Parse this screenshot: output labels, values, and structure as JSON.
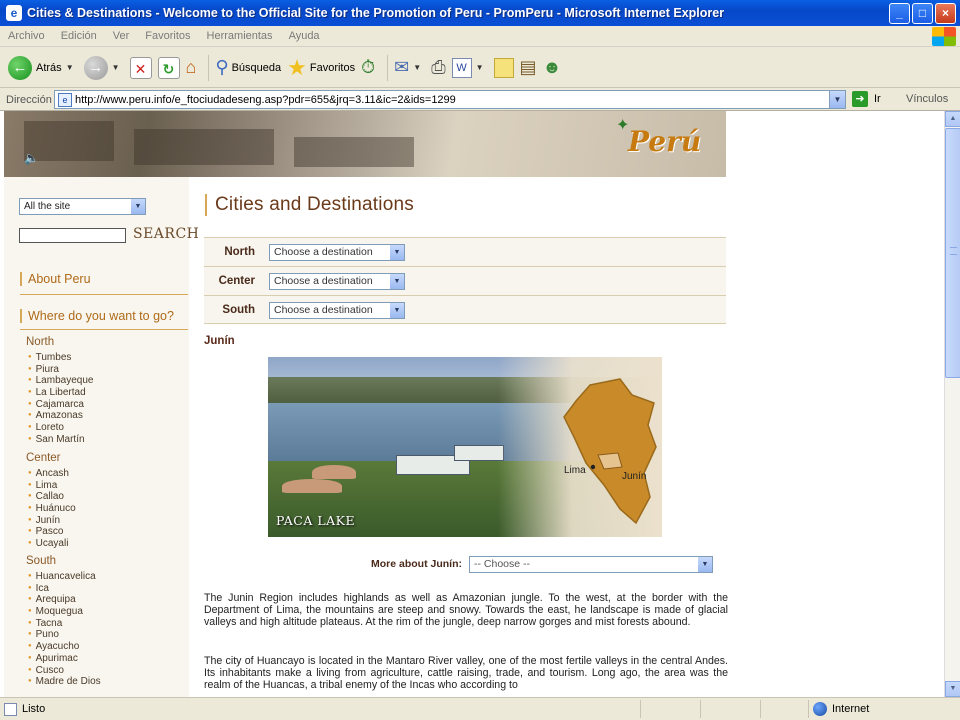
{
  "window": {
    "title": "Cities & Destinations - Welcome to the Official Site for the Promotion of Peru - PromPeru - Microsoft Internet Explorer",
    "buttons": {
      "minimize": "_",
      "maximize": "□",
      "close": "×"
    }
  },
  "menu": [
    "Archivo",
    "Edición",
    "Ver",
    "Favoritos",
    "Herramientas",
    "Ayuda"
  ],
  "toolbar": {
    "back_label": "Atrás",
    "search_label": "Búsqueda",
    "favorites_label": "Favoritos"
  },
  "address": {
    "label": "Dirección",
    "url": "http://www.peru.info/e_ftociudadeseng.asp?pdr=655&jrq=3.11&ic=2&ids=1299",
    "go_label": "Ir",
    "links_label": "Vínculos"
  },
  "status": {
    "left": "Listo",
    "zone": "Internet"
  },
  "page": {
    "logo_text": "Perú",
    "site_select": "All the site",
    "search_label": "SEARCH",
    "about_label": "About Peru",
    "where_label": "Where do you want to go?",
    "regions": [
      {
        "name": "North",
        "items": [
          "Tumbes",
          "Piura",
          "Lambayeque",
          "La Libertad",
          "Cajamarca",
          "Amazonas",
          "Loreto",
          "San Martín"
        ]
      },
      {
        "name": "Center",
        "items": [
          "Ancash",
          "Lima",
          "Callao",
          "Huánuco",
          "Junín",
          "Pasco",
          "Ucayali"
        ]
      },
      {
        "name": "South",
        "items": [
          "Huancavelica",
          "Ica",
          "Arequipa",
          "Moquegua",
          "Tacna",
          "Puno",
          "Ayacucho",
          "Apurimac",
          "Cusco",
          "Madre de Dios"
        ]
      }
    ],
    "title": "Cities and Destinations",
    "destination_rows": [
      {
        "label": "North",
        "placeholder": "Choose a destination"
      },
      {
        "label": "Center",
        "placeholder": "Choose a destination"
      },
      {
        "label": "South",
        "placeholder": "Choose a destination"
      }
    ],
    "section_name": "Junín",
    "photo_caption": "PACA LAKE",
    "map_labels": {
      "lima": "Lima",
      "junin": "Junín"
    },
    "more_label": "More about Junín:",
    "more_placeholder": "-- Choose --",
    "paragraphs": [
      "The Junin Region includes highlands as well as Amazonian jungle. To the west, at the border with the Department of Lima, the mountains are steep and snowy. Towards the east, he landscape is made of glacial valleys and high altitude plateaus. At the rim of the jungle, deep narrow gorges and mist forests abound.",
      "The city of Huancayo is located in the Mantaro River valley, one of the most fertile valleys in the central Andes. Its inhabitants make a living from agriculture, cattle raising, trade, and tourism. Long ago, the area was the realm of the Huancas, a tribal enemy of the Incas who according to"
    ]
  },
  "colors": {
    "accent": "#d8a85a",
    "title_blue": "#0a4fd6",
    "heading_brown": "#6a3a1a"
  }
}
